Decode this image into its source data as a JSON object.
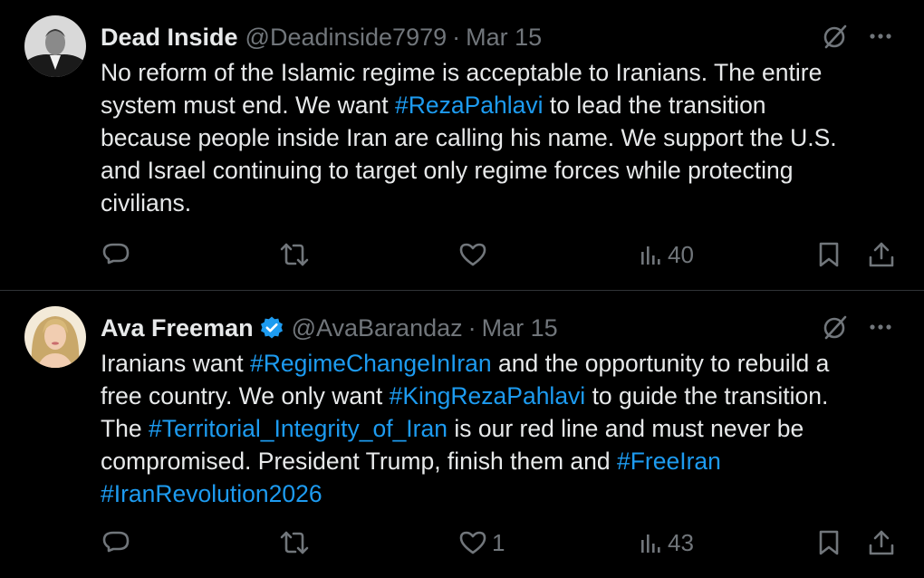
{
  "tweets": [
    {
      "name": "Dead Inside",
      "handle": "@Deadinside7979",
      "separator": "·",
      "date": "Mar 15",
      "verified": false,
      "lines": [
        [
          {
            "t": "No reform of the Islamic regime is acceptable to Iranians. The entire"
          }
        ],
        [
          {
            "t": "system must end. We want "
          },
          {
            "t": "#RezaPahlavi",
            "tag": true
          },
          {
            "t": " to lead the transition"
          }
        ],
        [
          {
            "t": "because people inside Iran are calling his name. We support the U.S."
          }
        ],
        [
          {
            "t": "and Israel continuing to target only regime forces while protecting"
          }
        ],
        [
          {
            "t": "civilians."
          }
        ]
      ],
      "actions": {
        "reply": "",
        "repost": "",
        "like": "",
        "views": "40"
      }
    },
    {
      "name": "Ava Freeman",
      "handle": "@AvaBarandaz",
      "separator": "·",
      "date": "Mar 15",
      "verified": true,
      "lines": [
        [
          {
            "t": "Iranians want "
          },
          {
            "t": "#RegimeChangeInIran",
            "tag": true
          },
          {
            "t": " and the opportunity to rebuild a"
          }
        ],
        [
          {
            "t": "free country. We only want "
          },
          {
            "t": "#KingRezaPahlavi",
            "tag": true
          },
          {
            "t": " to guide the transition."
          }
        ],
        [
          {
            "t": "The "
          },
          {
            "t": "#Territorial_Integrity_of_Iran",
            "tag": true
          },
          {
            "t": " is our red line and must never be"
          }
        ],
        [
          {
            "t": "compromised. President Trump, finish them and "
          },
          {
            "t": "#FreeIran",
            "tag": true
          }
        ],
        [
          {
            "t": "#IranRevolution2026",
            "tag": true
          }
        ]
      ],
      "actions": {
        "reply": "",
        "repost": "",
        "like": "1",
        "views": "43"
      }
    }
  ],
  "icons": {
    "grok": "grok-slash-circle-icon",
    "more": "more-dots-icon",
    "reply": "reply-bubble-icon",
    "repost": "repost-arrows-icon",
    "like": "heart-icon",
    "views": "views-bars-icon",
    "bookmark": "bookmark-icon",
    "share": "share-upload-icon",
    "verified": "verified-badge-icon"
  },
  "colors": {
    "background": "#000000",
    "text": "#e7e9ea",
    "muted": "#71767b",
    "link": "#1d9bf0",
    "divider": "#2f3336"
  }
}
